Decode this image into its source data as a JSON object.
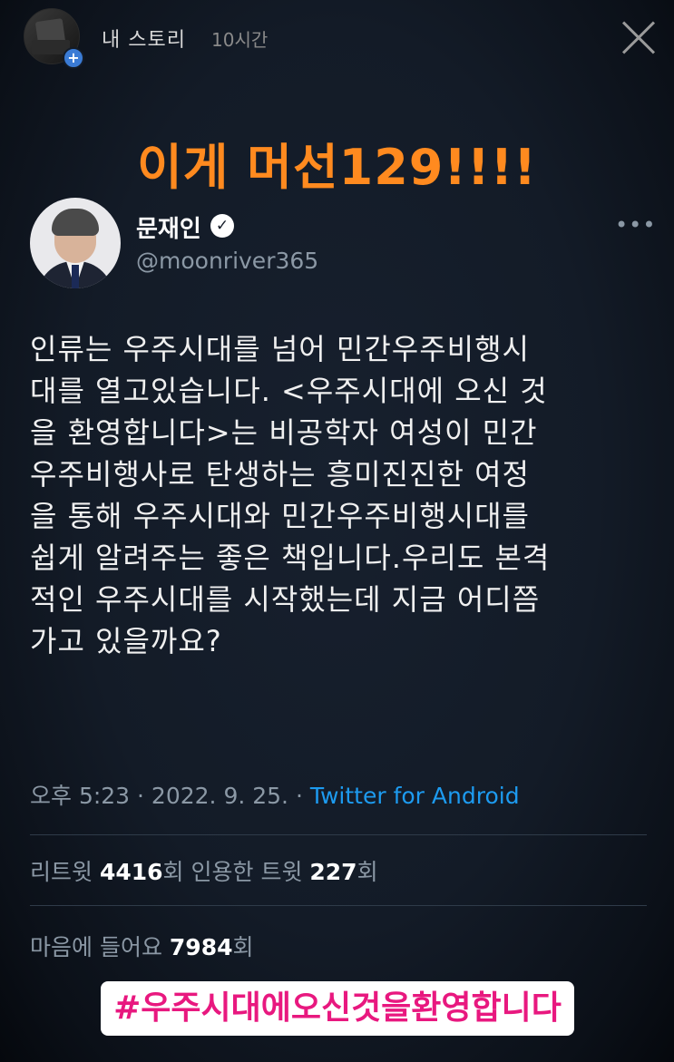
{
  "story": {
    "user_label": "내 스토리",
    "time_ago": "10시간",
    "plus_icon": "+",
    "close_icon": "close-icon"
  },
  "headline": "이게 머선129!!!!",
  "tweet": {
    "display_name": "문재인",
    "verified_icon": "✓",
    "handle": "@moonriver365",
    "more_icon": "•••",
    "text_lines": [
      "인류는 우주시대를 넘어 민간우주비행시",
      "대를 열고있습니다. <우주시대에 오신 것",
      "을 환영합니다>는 비공학자 여성이 민간",
      "우주비행사로 탄생하는 흥미진진한 여정",
      "을 통해 우주시대와 민간우주비행시대를",
      "쉽게 알려주는 좋은 책입니다.우리도 본격",
      "적인 우주시대를 시작했는데 지금 어디쯤",
      "가고 있을까요?"
    ],
    "timestamp": "오후 5:23 · 2022. 9. 25. · ",
    "source": "Twitter for Android",
    "retweets_label": "리트윗 ",
    "retweets_count": "4416",
    "retweets_unit": "회  인용한 트윗 ",
    "quotes_count": "227",
    "quotes_unit": "회",
    "likes_label": "마음에 들어요 ",
    "likes_count": "7984",
    "likes_unit": "회"
  },
  "hashtag_sticker": "#우주시대에오신것을환영합니다",
  "colors": {
    "headline": "#ff8a1f",
    "link": "#1d9bf0",
    "hashtag": "#e8187f",
    "background": "#131b27"
  }
}
